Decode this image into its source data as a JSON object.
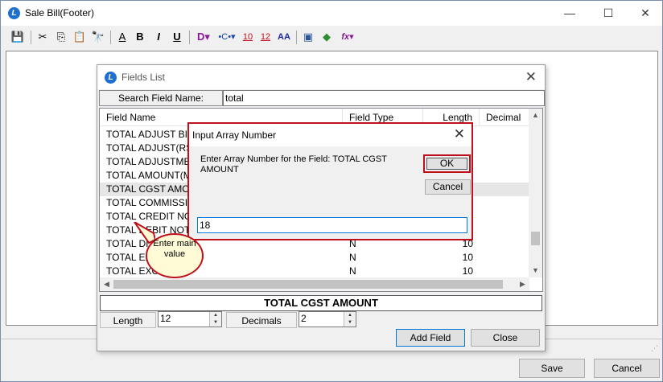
{
  "window": {
    "title": "Sale Bill(Footer)",
    "controls": {
      "minimize": "—",
      "maximize": "☐",
      "close": "✕"
    }
  },
  "toolbar": {
    "items": [
      {
        "name": "save-icon",
        "glyph": "💾"
      },
      {
        "name": "cut-icon",
        "glyph": "✂"
      },
      {
        "name": "copy-icon",
        "glyph": "⎘"
      },
      {
        "name": "paste-icon",
        "glyph": "📋"
      },
      {
        "name": "find-icon",
        "glyph": "🔭"
      },
      {
        "name": "font-icon",
        "glyph": "A"
      },
      {
        "name": "bold-icon",
        "glyph": "B"
      },
      {
        "name": "italic-icon",
        "glyph": "I"
      },
      {
        "name": "underline-icon",
        "glyph": "U"
      },
      {
        "name": "data-dropdown-icon",
        "glyph": "D▾"
      },
      {
        "name": "insert-dropdown-icon",
        "glyph": "•C•▾"
      },
      {
        "name": "number-10-icon",
        "glyph": "10"
      },
      {
        "name": "number-12-icon",
        "glyph": "12"
      },
      {
        "name": "font-size-icon",
        "glyph": "AA"
      },
      {
        "name": "properties-icon",
        "glyph": "▣"
      },
      {
        "name": "shapes-icon",
        "glyph": "◆"
      },
      {
        "name": "function-dropdown-icon",
        "glyph": "fx▾"
      }
    ]
  },
  "fields_list": {
    "title": "Fields List",
    "close": "✕",
    "search_label": "Search Field Name:",
    "search_value": "total",
    "columns": [
      "Field Name",
      "Field Type",
      "Length",
      "Decimal"
    ],
    "rows": [
      {
        "name": "TOTAL ADJUST BILL",
        "type": "",
        "length": ""
      },
      {
        "name": "TOTAL ADJUST(RS)",
        "type": "",
        "length": ""
      },
      {
        "name": "TOTAL ADJUSTMENT",
        "type": "",
        "length": ""
      },
      {
        "name": "TOTAL AMOUNT(M.",
        "type": "",
        "length": ""
      },
      {
        "name": "TOTAL CGST AMOUNT",
        "type": "",
        "length": ""
      },
      {
        "name": "TOTAL COMMISSION",
        "type": "",
        "length": ""
      },
      {
        "name": "TOTAL CREDIT NOTE",
        "type": "",
        "length": ""
      },
      {
        "name": "TOTAL DEBIT NOTE",
        "type": "",
        "length": ""
      },
      {
        "name": "TOTAL DI",
        "type": "N",
        "length": "10"
      },
      {
        "name": "TOTAL EX",
        "type": "N",
        "length": "10"
      },
      {
        "name": "TOTAL EXC",
        "type": "N",
        "length": "10"
      }
    ],
    "selected_row": 4,
    "selected_field": "TOTAL CGST AMOUNT",
    "length_label": "Length",
    "length_value": "12",
    "decimals_label": "Decimals",
    "decimals_value": "2",
    "add_field": "Add Field",
    "close_button": "Close"
  },
  "input_dialog": {
    "title": "Input Array Number",
    "close": "✕",
    "prompt": "Enter Array Number for the Field: TOTAL CGST AMOUNT",
    "ok": "OK",
    "cancel": "Cancel",
    "value": "18"
  },
  "callout": {
    "text": "Enter main value"
  },
  "footer": {
    "save": "Save",
    "cancel": "Cancel"
  }
}
